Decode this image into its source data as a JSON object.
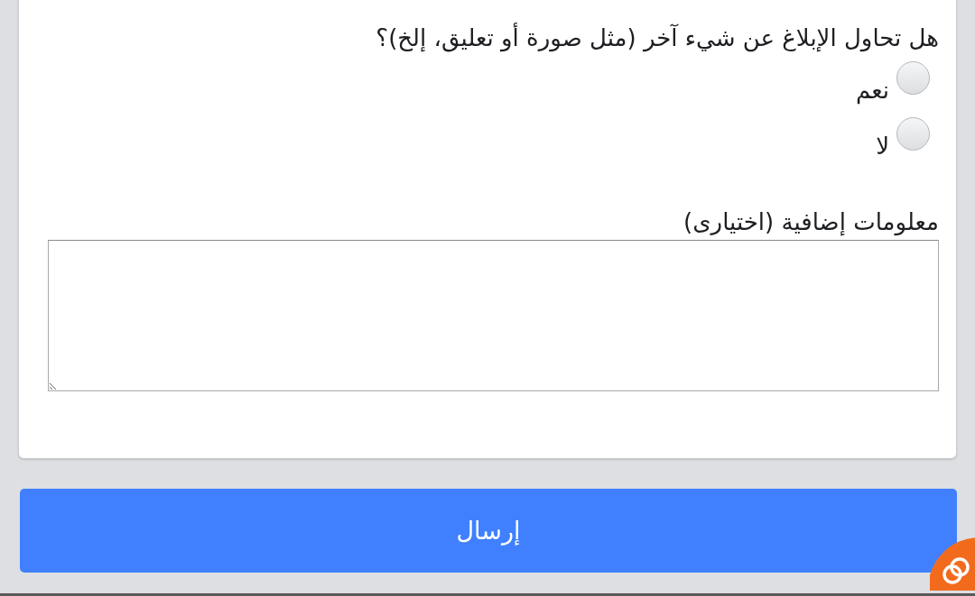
{
  "question": {
    "text": "هل تحاول الإبلاغ عن شيء آخر (مثل صورة أو تعليق، إلخ)؟",
    "options": [
      {
        "label": "نعم",
        "selected": false
      },
      {
        "label": "لا",
        "selected": false
      }
    ]
  },
  "additional_info": {
    "label": "معلومات إضافية (اختيارى)"
  },
  "submit_button": {
    "label": "إرسال"
  }
}
